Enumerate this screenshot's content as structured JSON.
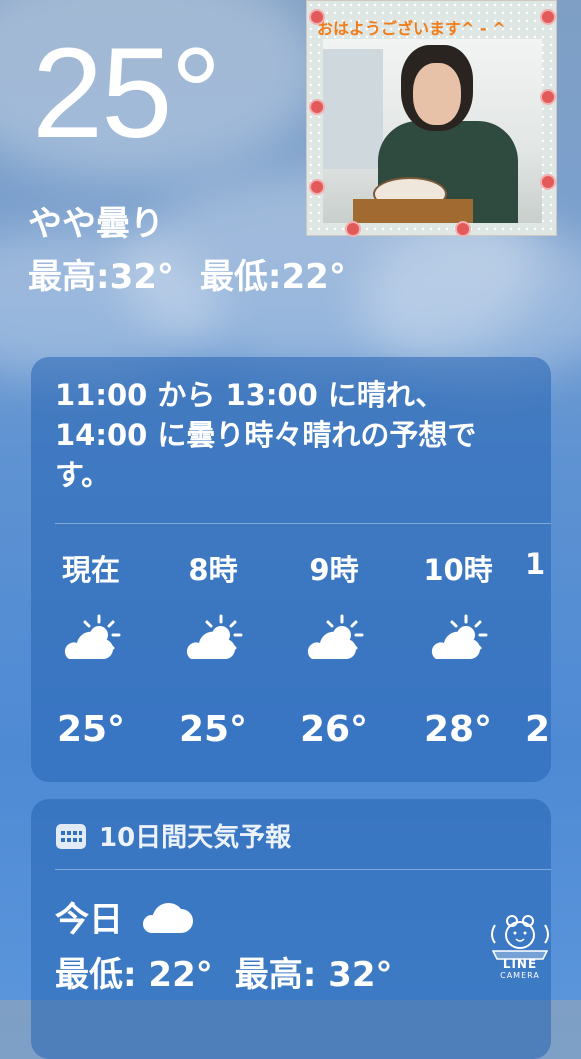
{
  "current": {
    "temperature": "25°",
    "condition": "やや曇り",
    "high": "最高:32°",
    "low": "最低:22°"
  },
  "photo": {
    "caption": "おはようございます^ - ^"
  },
  "hourly": {
    "summary": "11:00 から 13:00 に晴れ、14:00 に曇り時々晴れの予想です。",
    "hours": [
      {
        "label": "現在",
        "icon": "partly-cloudy-icon",
        "temp": "25°"
      },
      {
        "label": "8時",
        "icon": "partly-cloudy-icon",
        "temp": "25°"
      },
      {
        "label": "9時",
        "icon": "partly-cloudy-icon",
        "temp": "26°"
      },
      {
        "label": "10時",
        "icon": "partly-cloudy-icon",
        "temp": "28°"
      },
      {
        "label": "1",
        "icon": "partly-cloudy-icon",
        "temp": "2"
      }
    ]
  },
  "daily": {
    "title": "10日間天気予報",
    "icon": "calendar-icon",
    "today": {
      "label": "今日",
      "icon": "cloud-icon",
      "low": "最低: 22°",
      "high": "最高: 32°"
    }
  },
  "watermark": {
    "line1": "LINE",
    "line2": "CAMERA"
  }
}
